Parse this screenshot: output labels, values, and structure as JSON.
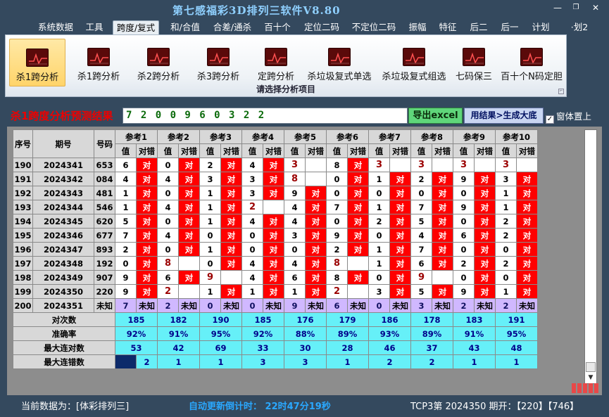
{
  "app": {
    "title": "第七感福彩3D排列三软件V8.80"
  },
  "window_controls": {
    "minimize": "—",
    "restore": "❐",
    "close": "✕"
  },
  "menu": [
    {
      "label": "系统数据",
      "active": false
    },
    {
      "label": "工具",
      "active": false
    },
    {
      "label": "跨度/复式",
      "active": true
    },
    {
      "label": "和/合值",
      "active": false
    },
    {
      "label": "合差/通杀",
      "active": false
    },
    {
      "label": "百十个",
      "active": false
    },
    {
      "label": "定位二码",
      "active": false
    },
    {
      "label": "不定位二码",
      "active": false
    },
    {
      "label": "振幅",
      "active": false
    },
    {
      "label": "特征",
      "active": false
    },
    {
      "label": "后二",
      "active": false
    },
    {
      "label": "后一",
      "active": false
    },
    {
      "label": "计划",
      "active": false
    },
    {
      "label": "·划2",
      "active": false
    }
  ],
  "ribbon": {
    "buttons": [
      {
        "label": "杀1跨分析",
        "selected": true
      },
      {
        "label": "杀1跨分析",
        "selected": false
      },
      {
        "label": "杀2跨分析",
        "selected": false
      },
      {
        "label": "杀3跨分析",
        "selected": false
      },
      {
        "label": "定跨分析",
        "selected": false
      },
      {
        "label": "杀垃圾复式单选",
        "selected": false
      },
      {
        "label": "杀垃圾复式组选",
        "selected": false
      },
      {
        "label": "七码保三",
        "selected": false
      },
      {
        "label": "百十个N码定胆",
        "selected": false
      }
    ],
    "group_label": "请选择分析项目",
    "corner": "⌐"
  },
  "result": {
    "title": "杀1跨度分析预测结果",
    "value": "7 2 0 0 9 6 0 3 2 2",
    "export_label": "导出excel",
    "generate_label": "用结果>生成大底",
    "on_top_label": "窗体置上",
    "on_top_checked": "✓"
  },
  "table": {
    "headers": {
      "seq": "序号",
      "period": "期号",
      "number": "号码",
      "value": "值",
      "check": "对错"
    },
    "ref_headers": [
      "参考1",
      "参考2",
      "参考3",
      "参考4",
      "参考5",
      "参考6",
      "参考7",
      "参考8",
      "参考9",
      "参考10"
    ],
    "rows": [
      {
        "seq": "190",
        "period": "2024341",
        "number": "653",
        "vals": [
          "6",
          "0",
          "2",
          "4",
          "3",
          "8",
          "3",
          "3",
          "3",
          "3"
        ],
        "marks": [
          "对",
          "对",
          "对",
          "对",
          "",
          "对",
          "",
          "",
          "",
          ""
        ]
      },
      {
        "seq": "191",
        "period": "2024342",
        "number": "084",
        "vals": [
          "4",
          "4",
          "3",
          "3",
          "8",
          "0",
          "1",
          "2",
          "9",
          "3"
        ],
        "marks": [
          "对",
          "对",
          "对",
          "对",
          "",
          "对",
          "对",
          "对",
          "对",
          "对"
        ]
      },
      {
        "seq": "192",
        "period": "2024343",
        "number": "481",
        "vals": [
          "1",
          "0",
          "1",
          "3",
          "9",
          "0",
          "0",
          "0",
          "0",
          "1"
        ],
        "marks": [
          "对",
          "对",
          "对",
          "对",
          "对",
          "对",
          "对",
          "对",
          "对",
          "对"
        ]
      },
      {
        "seq": "193",
        "period": "2024344",
        "number": "546",
        "vals": [
          "1",
          "4",
          "1",
          "2",
          "4",
          "7",
          "1",
          "7",
          "9",
          "1"
        ],
        "marks": [
          "对",
          "对",
          "对",
          "",
          "对",
          "对",
          "对",
          "对",
          "对",
          "对"
        ]
      },
      {
        "seq": "194",
        "period": "2024345",
        "number": "620",
        "vals": [
          "5",
          "0",
          "1",
          "4",
          "4",
          "0",
          "2",
          "5",
          "0",
          "2"
        ],
        "marks": [
          "对",
          "对",
          "对",
          "对",
          "对",
          "对",
          "对",
          "对",
          "对",
          "对"
        ]
      },
      {
        "seq": "195",
        "period": "2024346",
        "number": "677",
        "vals": [
          "7",
          "4",
          "0",
          "0",
          "3",
          "9",
          "0",
          "4",
          "6",
          "2"
        ],
        "marks": [
          "对",
          "对",
          "对",
          "对",
          "对",
          "对",
          "对",
          "对",
          "对",
          "对"
        ]
      },
      {
        "seq": "196",
        "period": "2024347",
        "number": "893",
        "vals": [
          "2",
          "0",
          "1",
          "0",
          "0",
          "2",
          "1",
          "7",
          "0",
          "0"
        ],
        "marks": [
          "对",
          "对",
          "对",
          "对",
          "对",
          "对",
          "对",
          "对",
          "对",
          "对"
        ]
      },
      {
        "seq": "197",
        "period": "2024348",
        "number": "192",
        "vals": [
          "0",
          "8",
          "0",
          "4",
          "4",
          "8",
          "1",
          "6",
          "2",
          "2"
        ],
        "marks": [
          "对",
          "",
          "对",
          "对",
          "对",
          "",
          "对",
          "对",
          "对",
          "对"
        ]
      },
      {
        "seq": "198",
        "period": "2024349",
        "number": "907",
        "vals": [
          "9",
          "6",
          "9",
          "4",
          "6",
          "8",
          "0",
          "9",
          "0",
          "0"
        ],
        "marks": [
          "对",
          "对",
          "",
          "对",
          "对",
          "对",
          "对",
          "",
          "对",
          "对"
        ]
      },
      {
        "seq": "199",
        "period": "2024350",
        "number": "220",
        "vals": [
          "9",
          "2",
          "1",
          "1",
          "1",
          "2",
          "3",
          "5",
          "9",
          "1"
        ],
        "marks": [
          "对",
          "",
          "对",
          "对",
          "对",
          "",
          "对",
          "对",
          "对",
          "对"
        ]
      },
      {
        "seq": "200",
        "period": "2024351",
        "number": "未知",
        "vals": [
          "7",
          "2",
          "0",
          "0",
          "9",
          "6",
          "0",
          "3",
          "2",
          "2"
        ],
        "marks": [
          "未知",
          "未知",
          "未知",
          "未知",
          "未知",
          "未知",
          "未知",
          "未知",
          "未知",
          "未知"
        ]
      }
    ],
    "stats": [
      {
        "label": "对次数",
        "values": [
          "185",
          "182",
          "190",
          "185",
          "176",
          "179",
          "186",
          "178",
          "183",
          "191"
        ]
      },
      {
        "label": "准确率",
        "values": [
          "92%",
          "91%",
          "95%",
          "92%",
          "88%",
          "89%",
          "93%",
          "89%",
          "91%",
          "95%"
        ]
      },
      {
        "label": "最大连对数",
        "values": [
          "53",
          "42",
          "69",
          "33",
          "30",
          "28",
          "46",
          "37",
          "43",
          "48"
        ]
      },
      {
        "label": "最大连错数",
        "values": [
          "2",
          "1",
          "1",
          "3",
          "3",
          "1",
          "2",
          "2",
          "1",
          "1"
        ]
      }
    ]
  },
  "scrollbar": {
    "down_arrow": "▼"
  },
  "status": {
    "current_data": "当前数据为：[体彩排列三]",
    "countdown": "自动更新倒计时：  22时47分19秒",
    "draw_info": "TCP3第 2024350 期开：【220】【746】"
  }
}
